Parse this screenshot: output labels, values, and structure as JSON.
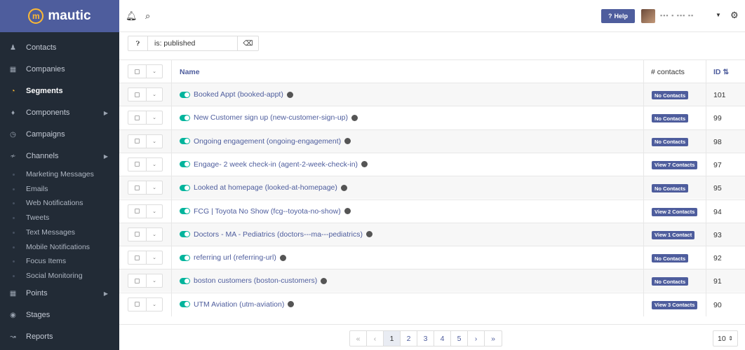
{
  "app": {
    "brand": "mautic"
  },
  "sidebar": {
    "items": [
      {
        "label": "Contacts",
        "icon": "user-icon",
        "active": false,
        "has_arrow": false
      },
      {
        "label": "Companies",
        "icon": "building-icon",
        "active": false,
        "has_arrow": false
      },
      {
        "label": "Segments",
        "icon": "pie-chart-icon",
        "active": true,
        "has_arrow": false
      },
      {
        "label": "Components",
        "icon": "puzzle-icon",
        "active": false,
        "has_arrow": true
      },
      {
        "label": "Campaigns",
        "icon": "clock-icon",
        "active": false,
        "has_arrow": false
      },
      {
        "label": "Channels",
        "icon": "rss-icon",
        "active": false,
        "has_arrow": true
      },
      {
        "label": "Points",
        "icon": "calculator-icon",
        "active": false,
        "has_arrow": true
      },
      {
        "label": "Stages",
        "icon": "tachometer-icon",
        "active": false,
        "has_arrow": false
      },
      {
        "label": "Reports",
        "icon": "line-chart-icon",
        "active": false,
        "has_arrow": false
      }
    ],
    "channels_sub": [
      "Marketing Messages",
      "Emails",
      "Web Notifications",
      "Tweets",
      "Text Messages",
      "Mobile Notifications",
      "Focus Items",
      "Social Monitoring"
    ]
  },
  "topbar": {
    "help_label": "Help",
    "user_name": "▪▪▪ ▪  ▪▪▪ ▪▪"
  },
  "filter": {
    "value": "is: published"
  },
  "table": {
    "headers": {
      "name": "Name",
      "contacts": "# contacts",
      "id": "ID"
    },
    "rows": [
      {
        "name": "Booked Appt (booked-appt)",
        "contacts": "No Contacts",
        "id": "101"
      },
      {
        "name": "New Customer sign up (new-customer-sign-up)",
        "contacts": "No Contacts",
        "id": "99"
      },
      {
        "name": "Ongoing engagement (ongoing-engagement)",
        "contacts": "No Contacts",
        "id": "98"
      },
      {
        "name": "Engage- 2 week check-in (agent-2-week-check-in)",
        "contacts": "View 7 Contacts",
        "id": "97"
      },
      {
        "name": "Looked at homepage (looked-at-homepage)",
        "contacts": "No Contacts",
        "id": "95"
      },
      {
        "name": "FCG | Toyota No Show (fcg--toyota-no-show)",
        "contacts": "View 2 Contacts",
        "id": "94"
      },
      {
        "name": "Doctors - MA - Pediatrics (doctors---ma---pediatrics)",
        "contacts": "View 1 Contact",
        "id": "93"
      },
      {
        "name": "referring url (referring-url)",
        "contacts": "No Contacts",
        "id": "92"
      },
      {
        "name": "boston customers (boston-customers)",
        "contacts": "No Contacts",
        "id": "91"
      },
      {
        "name": "UTM Aviation (utm-aviation)",
        "contacts": "View 3 Contacts",
        "id": "90"
      }
    ]
  },
  "pagination": {
    "pages": [
      "«",
      "‹",
      "1",
      "2",
      "3",
      "4",
      "5",
      "›",
      "»"
    ],
    "current": "1",
    "page_size": "10"
  },
  "colors": {
    "brand": "#4e5d9d",
    "toggle_on": "#00b49c",
    "sidebar_bg": "#222b36",
    "accent": "#fdb933"
  }
}
